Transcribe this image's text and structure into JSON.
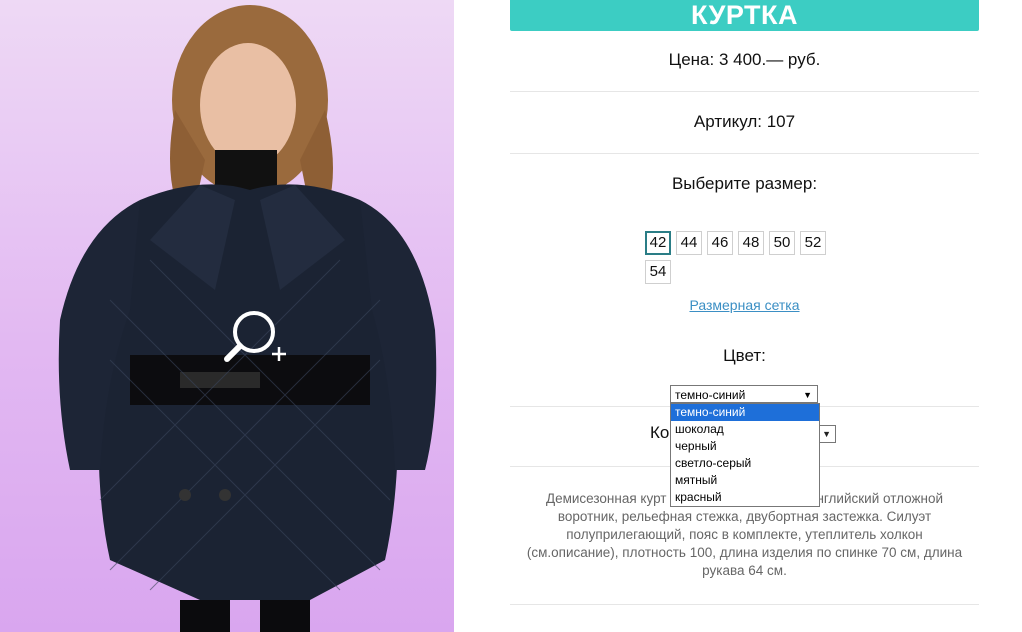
{
  "product": {
    "title": "КУРТКА",
    "price": "Цена: 3 400.— руб.",
    "article": "Артикул: 107",
    "choose_size_label": "Выберите размер:",
    "sizes": [
      "42",
      "44",
      "46",
      "48",
      "50",
      "52",
      "54"
    ],
    "selected_size": "42",
    "size_chart_link": "Размерная сетка",
    "color_label": "Цвет:",
    "color_selected": "темно-синий",
    "color_options": [
      "темно-синий",
      "шоколад",
      "черный",
      "светло-серый",
      "мятный",
      "красный"
    ],
    "quantity_label_visible": "Ко",
    "description_visible_line1": "Демисезонная курт",
    "description_visible_line1_end": "нглийский отложной",
    "description_rest": "воротник, рельефная стежка, двубортная застежка. Силуэт полуприлегающий, пояс в комплекте, утеплитель холкон (см.описание), плотность 100, длина изделия по спинке 70 см, длина рукава 64 см."
  },
  "colors": {
    "accent": "#3ccdc3",
    "link": "#3b8fc4",
    "dropdown_highlight": "#1e6fd9"
  },
  "icons": {
    "zoom": "zoom-in-icon"
  }
}
